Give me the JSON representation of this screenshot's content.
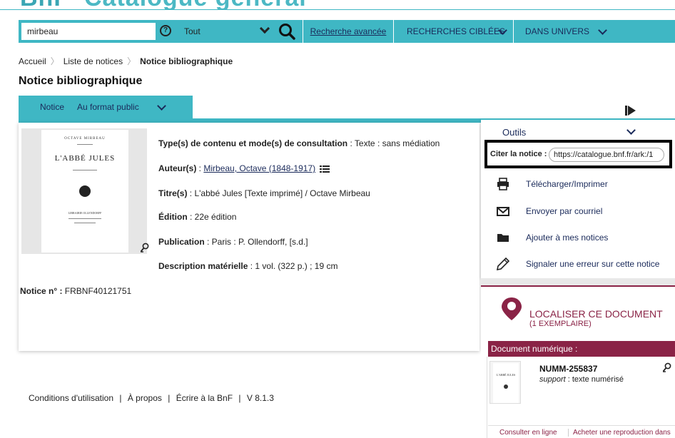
{
  "header": {
    "logo_text_a": "BnF",
    "logo_text_b": "Catalogue général"
  },
  "search": {
    "query": "mirbeau",
    "help_icon": "?",
    "scope": "Tout",
    "advanced_label": "Recherche avancée",
    "targeted_label": "RECHERCHES CIBLÉES",
    "universe_label": "DANS UNIVERS"
  },
  "breadcrumb": {
    "home": "Accueil",
    "list": "Liste de notices",
    "current": "Notice bibliographique"
  },
  "page_title": "Notice bibliographique",
  "notice_tab": {
    "label": "Notice",
    "format": "Au format public"
  },
  "cover": {
    "author_small": "OCTAVE MIRBEAU",
    "title": "L'ABBÉ JULES",
    "publisher": "LIBRAIRIE OLLENDORFF"
  },
  "record": {
    "content_type_label": "Type(s) de contenu et mode(s) de consultation",
    "content_type_value": " : Texte : sans médiation",
    "author_label": "Auteur(s)",
    "author_value": "Mirbeau, Octave (1848-1917)",
    "title_label": "Titre(s)",
    "title_value": " : L'abbé Jules [Texte imprimé] / Octave Mirbeau",
    "edition_label": "Édition",
    "edition_value": " : 22e édition",
    "publication_label": "Publication",
    "publication_value": " : Paris : P. Ollendorff, [s.d.]",
    "description_label": "Description matérielle",
    "description_value": " : 1 vol. (322 p.) ; 19 cm",
    "notice_no_label": "Notice n° :",
    "notice_no_value": " FRBNF40121751"
  },
  "footer": {
    "terms": "Conditions d'utilisation",
    "about": "À propos",
    "write": "Écrire à la BnF",
    "version": "V 8.1.3",
    "sep": "|"
  },
  "tools": {
    "title": "Outils",
    "cite_label": "Citer la notice :",
    "cite_url": "https://catalogue.bnf.fr/ark:/1",
    "items": [
      {
        "label": "Télécharger/Imprimer",
        "icon": "printer-icon"
      },
      {
        "label": "Envoyer par courriel",
        "icon": "envelope-icon"
      },
      {
        "label": "Ajouter à mes notices",
        "icon": "folder-icon"
      },
      {
        "label": "Signaler une erreur sur cette notice",
        "icon": "pencil-icon"
      }
    ]
  },
  "locate": {
    "title": "LOCALISER CE DOCUMENT",
    "subtitle": "(1 EXEMPLAIRE)",
    "doc_section": "Document numérique :",
    "doc_id": "NUMM-255837",
    "support_label": "support",
    "support_value": " : texte numérisé",
    "thumb_title": "L'ABBÉ JULES",
    "btn_consult": "Consulter en ligne",
    "btn_buy": "Acheter une reproduction dans"
  },
  "colors": {
    "teal": "#3fb7c4",
    "navy": "#1a2a5a",
    "burgundy": "#8a2346"
  }
}
